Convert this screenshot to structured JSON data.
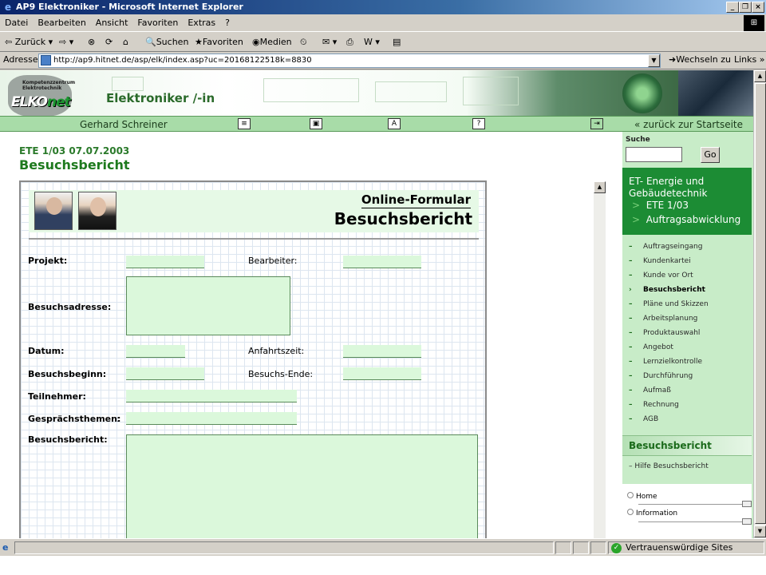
{
  "window": {
    "title": "AP9 Elektroniker - Microsoft Internet Explorer"
  },
  "menubar": {
    "items": [
      "Datei",
      "Bearbeiten",
      "Ansicht",
      "Favoriten",
      "Extras",
      "?"
    ]
  },
  "toolbar": {
    "back": "Zurück",
    "search": "Suchen",
    "favorites": "Favoriten",
    "media": "Medien"
  },
  "address": {
    "label": "Adresse",
    "url": "http://ap9.hitnet.de/asp/elk/index.asp?uc=20168122518k=8830",
    "go": "Wechseln zu",
    "links": "Links"
  },
  "header": {
    "logo_line1": "Kompetenzzentrum",
    "logo_line2": "Elektrotechnik",
    "logo_main": "ELKO",
    "logo_accent": "net",
    "site_title": "Elektroniker /-in",
    "user_name": "Gerhard Schreiner",
    "back_link": "zurück zur Startseite"
  },
  "page": {
    "unit_date": "ETE 1/03 07.07.2003",
    "heading": "Besuchsbericht"
  },
  "form": {
    "kicker": "Online-Formular",
    "title": "Besuchsbericht",
    "labels": {
      "projekt": "Projekt:",
      "bearbeiter": "Bearbeiter:",
      "besuchsadresse": "Besuchsadresse:",
      "datum": "Datum:",
      "anfahrtszeit": "Anfahrtszeit:",
      "besuchsbeginn": "Besuchsbeginn:",
      "besuchsende": "Besuchs-Ende:",
      "teilnehmer": "Teilnehmer:",
      "gespraechsthemen": "Gesprächsthemen:",
      "gespraechsthemen_colon": ":",
      "besuchsbericht": "Besuchsbericht:"
    }
  },
  "sidebar": {
    "search_label": "Suche",
    "go_label": "Go",
    "topic": "ET- Energie und Gebäudetechnik",
    "code": "ETE 1/03",
    "subtopic": "Auftragsabwicklung",
    "nav_items": [
      "Auftragseingang",
      "Kundenkartei",
      "Kunde vor Ort",
      "Besuchsbericht",
      "Pläne und Skizzen",
      "Arbeitsplanung",
      "Produktauswahl",
      "Angebot",
      "Lernzielkontrolle",
      "Durchführung",
      "Aufmaß",
      "Rechnung",
      "AGB"
    ],
    "active_item": "Besuchsbericht",
    "section_title": "Besuchsbericht",
    "help_link": "Hilfe Besuchsbericht",
    "bottom_links": [
      "Home",
      "Information"
    ]
  },
  "statusbar": {
    "zone": "Vertrauenswürdige Sites"
  },
  "colors": {
    "brand_green": "#1c8c34",
    "field_green": "#dbf8db",
    "sidebar_green": "#c8ecc8"
  }
}
